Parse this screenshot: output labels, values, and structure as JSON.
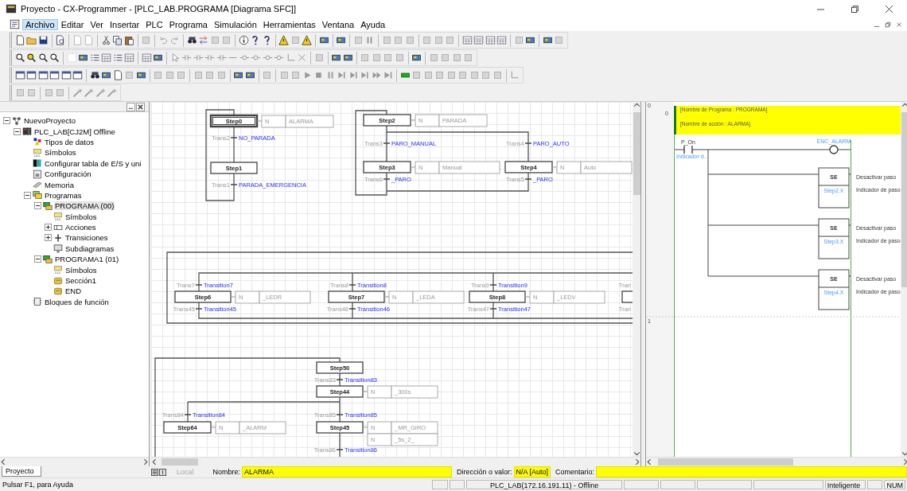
{
  "window": {
    "title": "Proyecto - CX-Programmer - [PLC_LAB.PROGRAMA [Diagrama SFC]]"
  },
  "menu": [
    {
      "label": "Archivo",
      "selected": true
    },
    {
      "label": "Editar",
      "selected": false
    },
    {
      "label": "Ver",
      "selected": false
    },
    {
      "label": "Insertar",
      "selected": false
    },
    {
      "label": "PLC",
      "selected": false
    },
    {
      "label": "Programa",
      "selected": false
    },
    {
      "label": "Simulación",
      "selected": false
    },
    {
      "label": "Herramientas",
      "selected": false
    },
    {
      "label": "Ventana",
      "selected": false
    },
    {
      "label": "Ayuda",
      "selected": false
    }
  ],
  "project_tree": {
    "tab": "Proyecto",
    "items": [
      {
        "label": "NuevoProyecto",
        "kind": "project",
        "expanded": true,
        "selected": false,
        "children": [
          {
            "label": "PLC_LAB[CJ2M] Offline",
            "kind": "plc",
            "expanded": true,
            "selected": false,
            "children": [
              {
                "label": "Tipos de datos",
                "kind": "datatypes",
                "selected": false
              },
              {
                "label": "Símbolos",
                "kind": "symbols",
                "selected": false
              },
              {
                "label": "Configurar tabla de E/S y uni",
                "kind": "io",
                "selected": false
              },
              {
                "label": "Configuración",
                "kind": "settings",
                "selected": false
              },
              {
                "label": "Memoria",
                "kind": "memory",
                "selected": false
              },
              {
                "label": "Programas",
                "kind": "programs",
                "expanded": true,
                "selected": false,
                "children": [
                  {
                    "label": "PROGRAMA (00)",
                    "kind": "program",
                    "expanded": true,
                    "selected": true,
                    "children": [
                      {
                        "label": "Símbolos",
                        "kind": "symbols",
                        "selected": false
                      },
                      {
                        "label": "Acciones",
                        "kind": "actions",
                        "expanded": false,
                        "selected": false
                      },
                      {
                        "label": "Transiciones",
                        "kind": "transitions",
                        "expanded": false,
                        "selected": false
                      },
                      {
                        "label": "Subdiagramas",
                        "kind": "subdiagram",
                        "selected": false
                      }
                    ]
                  },
                  {
                    "label": "PROGRAMA1 (01)",
                    "kind": "program",
                    "expanded": true,
                    "selected": false,
                    "children": [
                      {
                        "label": "Símbolos",
                        "kind": "symbols",
                        "selected": false
                      },
                      {
                        "label": "Sección1",
                        "kind": "section",
                        "selected": false
                      },
                      {
                        "label": "END",
                        "kind": "section",
                        "selected": false
                      }
                    ]
                  }
                ]
              },
              {
                "label": "Bloques de función",
                "kind": "fb",
                "selected": false
              }
            ]
          }
        ]
      }
    ]
  },
  "sfc": {
    "steps": [
      {
        "name": "Step0",
        "initial": true,
        "actions": [
          {
            "qualifier": "N",
            "name": "ALARMA"
          }
        ]
      },
      {
        "name": "Step1",
        "initial": false
      },
      {
        "name": "Step2",
        "initial": false,
        "actions": [
          {
            "qualifier": "N",
            "name": "PARADA"
          }
        ]
      },
      {
        "name": "Step3",
        "initial": false,
        "actions": [
          {
            "qualifier": "N",
            "name": "Manual"
          }
        ]
      },
      {
        "name": "Step4",
        "initial": false,
        "actions": [
          {
            "qualifier": "N",
            "name": "Auto"
          }
        ]
      },
      {
        "name": "Step6",
        "initial": false,
        "actions": [
          {
            "qualifier": "N",
            "name": "_LEDR"
          }
        ]
      },
      {
        "name": "Step7",
        "initial": false,
        "actions": [
          {
            "qualifier": "N",
            "name": "_LEDA"
          }
        ]
      },
      {
        "name": "Step8",
        "initial": false,
        "actions": [
          {
            "qualifier": "N",
            "name": "_LEDV"
          }
        ]
      },
      {
        "name": "Step50",
        "initial": false
      },
      {
        "name": "Step44",
        "initial": false,
        "actions": [
          {
            "qualifier": "N",
            "name": "_300s"
          }
        ]
      },
      {
        "name": "Step64",
        "initial": false,
        "actions": [
          {
            "qualifier": "N",
            "name": "_ALARM"
          }
        ]
      },
      {
        "name": "Step45",
        "initial": false,
        "actions": [
          {
            "qualifier": "N",
            "name": "_MR_GIRO"
          },
          {
            "qualifier": "N",
            "name": "_5s_2_"
          }
        ]
      }
    ],
    "transitions": [
      {
        "label": "Trans2",
        "condition": "NO_PARADA"
      },
      {
        "label": "Trans1",
        "condition": "PARADA_EMERGENCIA"
      },
      {
        "label": "Trans3",
        "condition": "PARO_MANUAL"
      },
      {
        "label": "Trans4",
        "condition": "PARO_AUTO"
      },
      {
        "label": "Trans6",
        "condition": "_PARO"
      },
      {
        "label": "Trans5",
        "condition": "_PARO"
      },
      {
        "label": "Trans7",
        "condition": "Transition7"
      },
      {
        "label": "Trans45",
        "condition": "Transition45"
      },
      {
        "label": "Trans8",
        "condition": "Transition8"
      },
      {
        "label": "Trans46",
        "condition": "Transition46"
      },
      {
        "label": "Trans9",
        "condition": "Transition9"
      },
      {
        "label": "Trans47",
        "condition": "Transition47"
      },
      {
        "label": "Tran"
      },
      {
        "label": "Tran"
      },
      {
        "label": "Trans83",
        "condition": "Transition83"
      },
      {
        "label": "Trans84",
        "condition": "Transition84"
      },
      {
        "label": "Trans85",
        "condition": "Transition85"
      },
      {
        "label": "Trans86",
        "condition": "Transition86"
      }
    ]
  },
  "ladder": {
    "rungs": [
      {
        "number": "0",
        "address": "0"
      },
      {
        "number": "1"
      }
    ],
    "comments": [
      "[Nombre de Programa : PROGRAMA]",
      "[Nombre de acción : ALARMA]"
    ],
    "contact": {
      "name": "P_On",
      "comment": "Indicador d..."
    },
    "coil": {
      "name": "ENC_ALARM"
    },
    "instructions": [
      {
        "mnemonic": "SE",
        "operand": "Step2.X",
        "description": "Desactivar paso",
        "operand_comment": "Indicador de paso"
      },
      {
        "mnemonic": "SE",
        "operand": "Step3.X",
        "description": "Desactivar paso",
        "operand_comment": "Indicador de paso"
      },
      {
        "mnemonic": "SE",
        "operand": "Step4.X",
        "description": "Desactivar paso",
        "operand_comment": "Indicador de paso"
      }
    ]
  },
  "properties_bar": {
    "scope": "Local",
    "scope_disabled": true,
    "name_label": "Nombre:",
    "name_value": "ALARMA",
    "address_label": "Dirección o valor:",
    "address_value": "N/A [Auto]",
    "comment_label": "Comentario:"
  },
  "status_bar": {
    "help": "Pulsar F1, para Ayuda",
    "connection": "PLC_LAB(172.16.191.11) - Offline",
    "mode": "Inteligente",
    "keyboard": "NUM"
  }
}
